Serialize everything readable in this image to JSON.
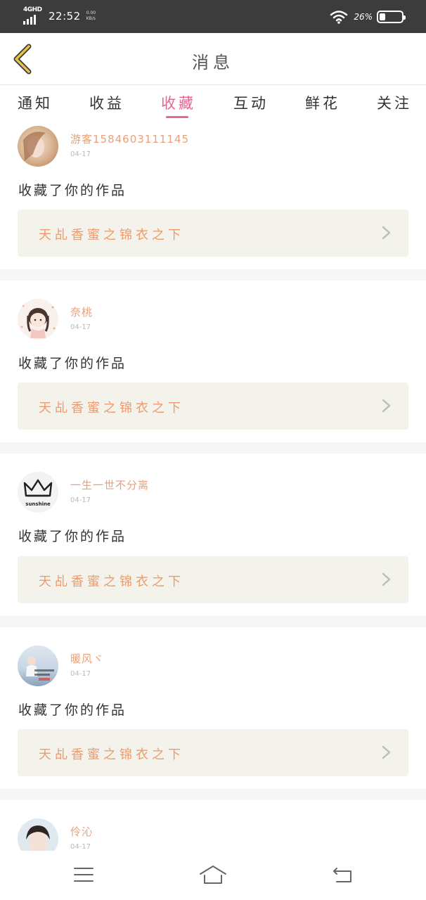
{
  "status_bar": {
    "network": "4GHD",
    "time": "22:52",
    "speed_value": "0.00",
    "speed_unit": "KB/s",
    "battery_percent": "26%",
    "battery_level": 0.26,
    "signal_icon": "signal-bars-icon",
    "wifi_icon": "wifi-icon",
    "battery_icon": "battery-icon"
  },
  "header": {
    "title": "消息",
    "back_icon": "chevron-left-icon"
  },
  "tabs": [
    {
      "label": "通知",
      "active": false
    },
    {
      "label": "收益",
      "active": false
    },
    {
      "label": "收藏",
      "active": true
    },
    {
      "label": "互动",
      "active": false
    },
    {
      "label": "鲜花",
      "active": false
    },
    {
      "label": "关注",
      "active": false
    }
  ],
  "feed": [
    {
      "username": "游客1584603111145",
      "date": "04-17",
      "action": "收藏了你的作品",
      "work_title": "天乩香蜜之锦衣之下",
      "avatar_icon": "user-avatar-photo"
    },
    {
      "username": "奈桃",
      "date": "04-17",
      "action": "收藏了你的作品",
      "work_title": "天乩香蜜之锦衣之下",
      "avatar_icon": "user-avatar-cartoon-girl"
    },
    {
      "username": "一生一世不分离",
      "date": "04-17",
      "action": "收藏了你的作品",
      "work_title": "天乩香蜜之锦衣之下",
      "avatar_icon": "user-avatar-crown",
      "avatar_caption": "sunshine"
    },
    {
      "username": "暖风ヾ",
      "date": "04-17",
      "action": "收藏了你的作品",
      "work_title": "天乩香蜜之锦衣之下",
      "avatar_icon": "user-avatar-photo"
    },
    {
      "username": "伶沁",
      "date": "04-17",
      "action": "",
      "work_title": "",
      "avatar_icon": "user-avatar-photo"
    }
  ],
  "nav_bar": {
    "menu_icon": "menu-icon",
    "home_icon": "home-icon",
    "back_icon": "back-arrow-icon"
  },
  "colors": {
    "accent": "#e2688e",
    "username": "#e8a07a",
    "work_title": "#ee9a6c",
    "work_box_bg": "#f3f3ec",
    "status_bar_bg": "#3c3c3c",
    "back_chevron": "#e6c24a"
  }
}
